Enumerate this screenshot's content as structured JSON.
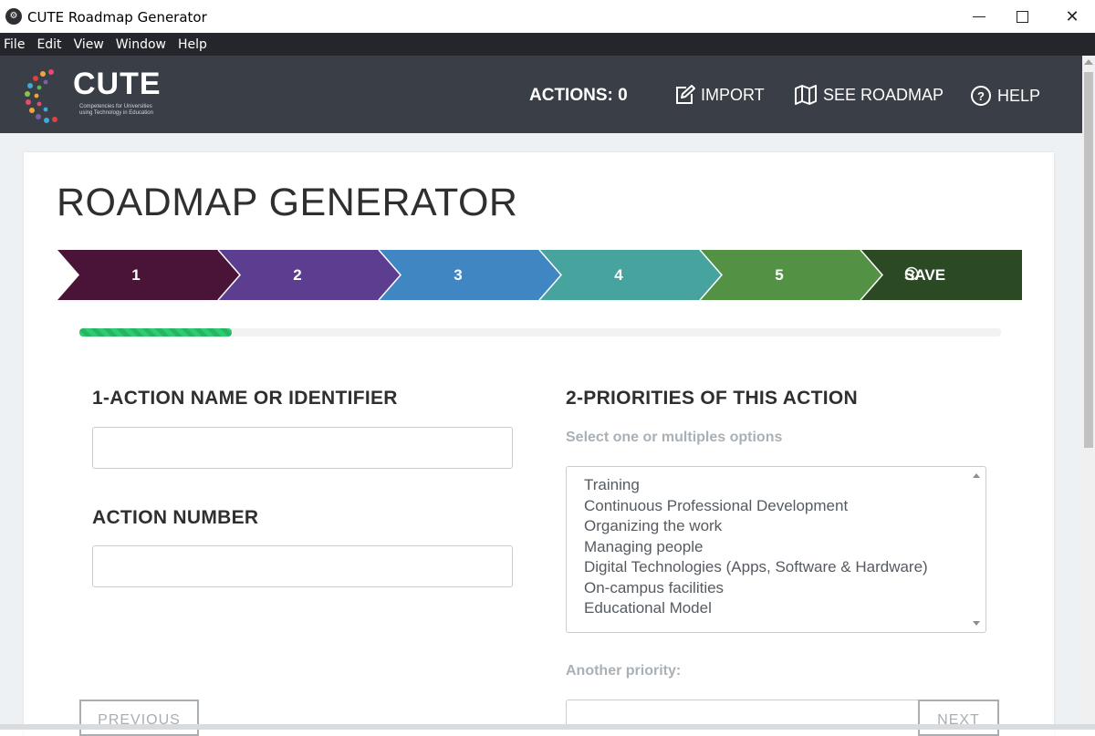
{
  "window": {
    "title": "CUTE Roadmap Generator",
    "app_icon": "cute-app-icon"
  },
  "menu": {
    "items": [
      "File",
      "Edit",
      "Window",
      "Help"
    ],
    "file": "File",
    "edit": "Edit",
    "view": "View",
    "window": "Window",
    "help": "Help"
  },
  "header": {
    "logo_text": "CUTE",
    "logo_sub_1": "Competencies for Universities",
    "logo_sub_2": "using Technology in Education",
    "actions_label": "ACTIONS: 0",
    "import_label": "IMPORT",
    "roadmap_label": "SEE ROADMAP",
    "help_label": "HELP"
  },
  "page": {
    "title": "ROADMAP GENERATOR"
  },
  "steps": {
    "s1": "1",
    "s2": "2",
    "s3": "3",
    "s4": "4",
    "s5": "5",
    "save": "SAVE",
    "colors": [
      "#4a1438",
      "#5c3d8f",
      "#3f86c2",
      "#46a39d",
      "#539245",
      "#2b4a24"
    ]
  },
  "progress": {
    "fraction": 0.165
  },
  "form": {
    "action_name_label": "1-ACTION NAME OR IDENTIFIER",
    "action_name_value": "",
    "action_number_label": "ACTION NUMBER",
    "action_number_value": "",
    "priorities_label": "2-PRIORITIES OF THIS ACTION",
    "priorities_hint": "Select one or multiples options",
    "priorities_options": [
      "Training",
      "Continuous Professional Development",
      "Organizing the work",
      "Managing people",
      "Digital Technologies (Apps, Software & Hardware)",
      "On-campus facilities",
      "Educational Model"
    ],
    "another_priority_label": "Another priority:",
    "another_priority_value": ""
  },
  "buttons": {
    "previous": "PREVIOUS",
    "next": "NEXT"
  }
}
